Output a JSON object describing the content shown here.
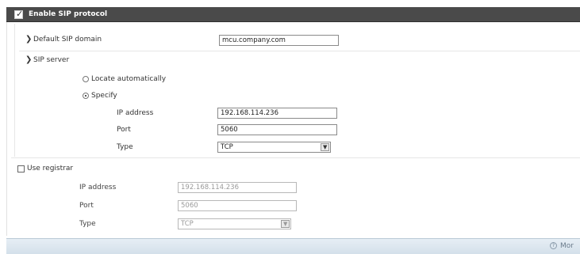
{
  "header": {
    "title": "Enable SIP protocol",
    "checked": true,
    "check_glyph": "✓"
  },
  "glyphs": {
    "arrow": "❯",
    "dropdown": "▼"
  },
  "sip": {
    "default_domain_label": "Default SIP domain",
    "default_domain_value": "mcu.company.com",
    "server_label": "SIP server",
    "locate_label": "Locate automatically",
    "specify_label": "Specify",
    "selected_option": "Specify",
    "ip_label": "IP address",
    "ip_value": "192.168.114.236",
    "port_label": "Port",
    "port_value": "5060",
    "type_label": "Type",
    "type_value": "TCP"
  },
  "registrar": {
    "label": "Use registrar",
    "checked": false,
    "ip_label": "IP address",
    "ip_value": "192.168.114.236",
    "port_label": "Port",
    "port_value": "5060",
    "type_label": "Type",
    "type_value": "TCP"
  },
  "footer": {
    "more_label": "Mor"
  }
}
